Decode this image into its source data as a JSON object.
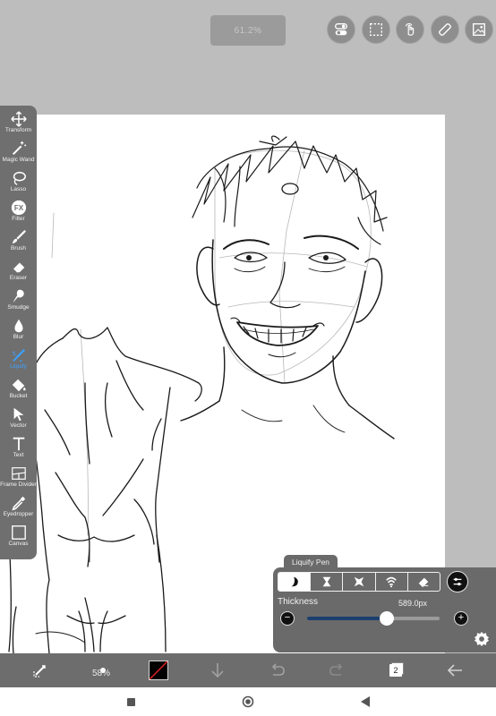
{
  "zoom": {
    "value": "61.2%"
  },
  "top_actions": [
    {
      "name": "toggle-icon"
    },
    {
      "name": "selection-icon"
    },
    {
      "name": "touch-icon"
    },
    {
      "name": "ruler-icon"
    },
    {
      "name": "material-icon"
    }
  ],
  "tools": [
    {
      "label": "Transform",
      "icon": "transform-icon"
    },
    {
      "label": "Magic Wand",
      "icon": "magic-wand-icon"
    },
    {
      "label": "Lasso",
      "icon": "lasso-icon"
    },
    {
      "label": "Filter",
      "icon": "filter-icon"
    },
    {
      "label": "Brush",
      "icon": "brush-icon"
    },
    {
      "label": "Eraser",
      "icon": "eraser-icon"
    },
    {
      "label": "Smudge",
      "icon": "smudge-icon"
    },
    {
      "label": "Blur",
      "icon": "blur-icon"
    },
    {
      "label": "Liquify",
      "icon": "liquify-icon",
      "active": true
    },
    {
      "label": "Bucket",
      "icon": "bucket-icon"
    },
    {
      "label": "Vector",
      "icon": "vector-icon"
    },
    {
      "label": "Text",
      "icon": "text-icon"
    },
    {
      "label": "Frame Divider",
      "icon": "frame-divider-icon"
    },
    {
      "label": "Eyedropper",
      "icon": "eyedropper-icon"
    },
    {
      "label": "Canvas",
      "icon": "canvas-icon"
    }
  ],
  "liquify": {
    "tab_label": "Liquify Pen",
    "modes": [
      "push",
      "pinch",
      "expand",
      "twirl",
      "restore"
    ],
    "selected_mode": "push",
    "thickness_label": "Thickness",
    "thickness_value": "589.0px",
    "slider_fraction": 0.6
  },
  "bottom": {
    "brush_size": "58%",
    "layer_count": "2"
  },
  "colors": {
    "accent": "#3ea0ff",
    "panel": "#6a6a6a",
    "toolbar": "#6f6f6f",
    "slider_fill": "#1c3f6e"
  }
}
